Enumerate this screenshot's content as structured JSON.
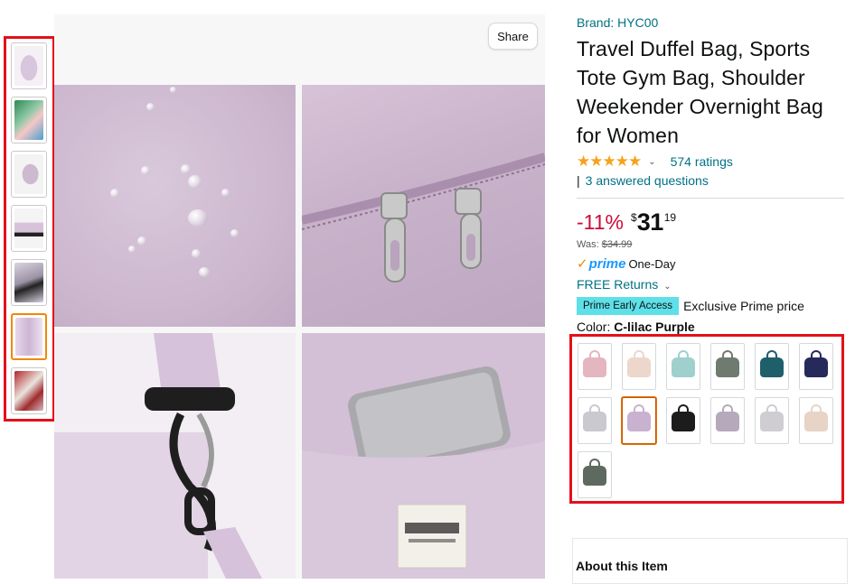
{
  "share_label": "Share",
  "brand": "Brand: HYC00",
  "title": "Travel Duffel Bag, Sports Tote Gym Bag, Shoulder Weekender Overnight Bag for Women",
  "rating": {
    "stars": "★★★★★",
    "ratings_text": "574 ratings",
    "answered_bar": "|",
    "answered_text": "3 answered questions"
  },
  "price": {
    "discount": "-11%",
    "currency": "$",
    "whole": "31",
    "fraction": "19",
    "was_label": "Was:",
    "was_price": "$34.99"
  },
  "prime": {
    "check": "✓",
    "word": "prime",
    "delivery": "One-Day"
  },
  "returns": "FREE Returns",
  "early_access": {
    "badge": "Prime Early Access",
    "text": "Exclusive Prime price"
  },
  "color": {
    "label": "Color:",
    "value": "C-lilac Purple"
  },
  "swatch_colors": [
    "#e4b6bf",
    "#edd6cc",
    "#9fd0cd",
    "#6f7b6f",
    "#1f5f6b",
    "#262a5a",
    "#c9c9cf",
    "#c8b2cf",
    "#1c1c1c",
    "#b6a9bc",
    "#cfcdd1",
    "#e8d3c7",
    "#5e6a5f"
  ],
  "selected_swatch_index": 7,
  "about_heading": "About this Item",
  "colors": {
    "link": "#007185",
    "deal_red": "#cc0c39",
    "star": "#f6a21c",
    "prime_blue": "#1a98ff",
    "highlight_border": "#e3101a",
    "early_badge": "#5ee0e8"
  }
}
